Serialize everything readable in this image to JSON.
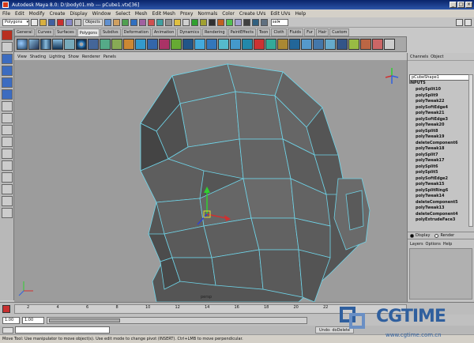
{
  "window": {
    "title": "Autodesk Maya 8.0: D:\\body01.mb    ---    pCube1.vtx[36]",
    "controls": [
      "_",
      "□",
      "×"
    ]
  },
  "menubar": [
    "File",
    "Edit",
    "Modify",
    "Create",
    "Display",
    "Window",
    "Select",
    "Mesh",
    "Edit Mesh",
    "Proxy",
    "Normals",
    "Color",
    "Create UVs",
    "Edit UVs",
    "Help"
  ],
  "statusline": {
    "mode": "Polygons",
    "objects_label": "Objects",
    "sel_label": "sel▾"
  },
  "shelf_tabs": [
    "General",
    "Curves",
    "Surfaces",
    "Polygons",
    "Subdivs",
    "Deformation",
    "Animation",
    "Dynamics",
    "Rendering",
    "PaintEffects",
    "Toon",
    "Cloth",
    "Fluids",
    "Fur",
    "Hair",
    "Custom"
  ],
  "shelf_active": "Polygons",
  "panel_menu": [
    "View",
    "Shading",
    "Lighting",
    "Show",
    "Renderer",
    "Panels"
  ],
  "channel_box": {
    "header": [
      "Channels",
      "Object"
    ],
    "object": "pCubeShape1",
    "inputs_label": "INPUTS",
    "inputs": [
      "polySplit10",
      "polySplit9",
      "polyTweak22",
      "polySoftEdge4",
      "polyTweak21",
      "polySoftEdge3",
      "polyTweak20",
      "polySplit8",
      "polyTweak19",
      "deleteComponent6",
      "polyTweak18",
      "polySplit7",
      "polyTweak17",
      "polySplit6",
      "polySplit5",
      "polySoftEdge2",
      "polyTweak15",
      "polySplitRing6",
      "polyTweak14",
      "deleteComponent5",
      "polyTweak13",
      "deleteComponent4",
      "polyExtrudeFace3"
    ]
  },
  "layer_editor": {
    "display_label": "Display",
    "render_label": "Render",
    "menu": [
      "Layers",
      "Options",
      "Help"
    ]
  },
  "timeline": {
    "ticks": [
      "2",
      "4",
      "6",
      "8",
      "10",
      "12",
      "14",
      "16",
      "18",
      "20",
      "22"
    ]
  },
  "range": {
    "start": "1.00",
    "playback_start": "1.00"
  },
  "command_line": {
    "undo_text": "Undo: doDelete"
  },
  "help_line": "Move Tool: Use manipulator to move object(s). Use edit mode to change pivot (INSERT). Ctrl+LMB to move perpendicular.",
  "viewport": {
    "camera_label": "persp"
  },
  "watermark": {
    "brand": "CGTIME",
    "url": "www.cgtime.com.cn"
  },
  "colors": {
    "viewport_bg": "#9c9c9c",
    "mesh_face": "#5a5a5a",
    "wire": "#6fd4e8",
    "title_bar": "#0a246a"
  }
}
